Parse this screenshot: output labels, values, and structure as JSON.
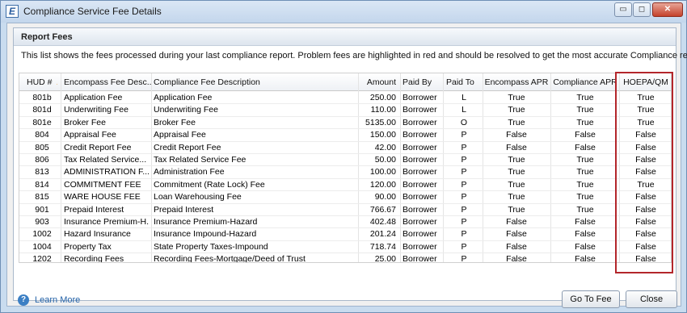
{
  "window": {
    "title": "Compliance Service Fee Details",
    "app_icon": "E",
    "minimize": "▭",
    "maximize": "◻",
    "close": "✕"
  },
  "panel": {
    "title": "Report Fees",
    "description": "This list shows the fees processed during your last compliance report. Problem fees are highlighted in red and should be resolved to get the most accurate Compliance report."
  },
  "columns": [
    "HUD #",
    "Encompass Fee Desc...",
    "Compliance Fee Description",
    "Amount",
    "Paid By",
    "Paid To",
    "Encompass APR",
    "Compliance APR",
    "HOEPA/QM"
  ],
  "sort_indicator": "▲",
  "rows": [
    [
      "801b",
      "Application Fee",
      "Application Fee",
      "250.00",
      "Borrower",
      "L",
      "True",
      "True",
      "True"
    ],
    [
      "801d",
      "Underwriting Fee",
      "Underwriting Fee",
      "110.00",
      "Borrower",
      "L",
      "True",
      "True",
      "True"
    ],
    [
      "801e",
      "Broker Fee",
      "Broker Fee",
      "5135.00",
      "Borrower",
      "O",
      "True",
      "True",
      "True"
    ],
    [
      "804",
      "Appraisal Fee",
      "Appraisal Fee",
      "150.00",
      "Borrower",
      "P",
      "False",
      "False",
      "False"
    ],
    [
      "805",
      "Credit Report Fee",
      "Credit Report Fee",
      "42.00",
      "Borrower",
      "P",
      "False",
      "False",
      "False"
    ],
    [
      "806",
      "Tax Related Service...",
      "Tax Related Service Fee",
      "50.00",
      "Borrower",
      "P",
      "True",
      "True",
      "False"
    ],
    [
      "813",
      "ADMINISTRATION F...",
      "Administration Fee",
      "100.00",
      "Borrower",
      "P",
      "True",
      "True",
      "False"
    ],
    [
      "814",
      "COMMITMENT FEE",
      "Commitment (Rate Lock) Fee",
      "120.00",
      "Borrower",
      "P",
      "True",
      "True",
      "True"
    ],
    [
      "815",
      "WARE HOUSE FEE",
      "Loan Warehousing Fee",
      "90.00",
      "Borrower",
      "P",
      "True",
      "True",
      "False"
    ],
    [
      "901",
      "Prepaid Interest",
      "Prepaid Interest",
      "766.67",
      "Borrower",
      "P",
      "True",
      "True",
      "False"
    ],
    [
      "903",
      "Insurance Premium-H...",
      "Insurance Premium-Hazard",
      "402.48",
      "Borrower",
      "P",
      "False",
      "False",
      "False"
    ],
    [
      "1002",
      "Hazard Insurance",
      "Insurance Impound-Hazard",
      "201.24",
      "Borrower",
      "P",
      "False",
      "False",
      "False"
    ],
    [
      "1004",
      "Property Tax",
      "State Property Taxes-Impound",
      "718.74",
      "Borrower",
      "P",
      "False",
      "False",
      "False"
    ],
    [
      "1202",
      "Recording Fees",
      "Recording Fees-Mortgage/Deed of Trust",
      "25.00",
      "Borrower",
      "P",
      "False",
      "False",
      "False"
    ]
  ],
  "footer": {
    "help_icon": "?",
    "learn_more": "Learn More",
    "go_to_fee": "Go To Fee",
    "close": "Close"
  },
  "colors": {
    "highlight_border": "#b3262b",
    "link": "#2563a8"
  }
}
